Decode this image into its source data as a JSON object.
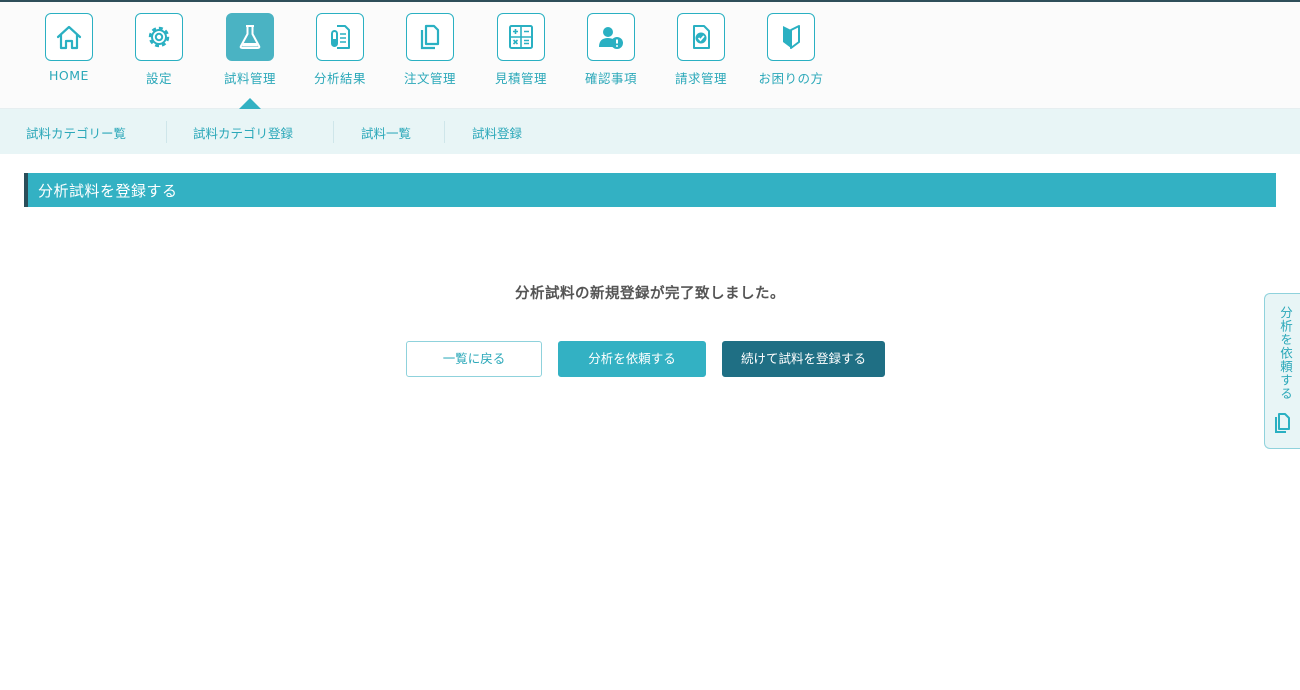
{
  "nav": {
    "items": [
      {
        "label": "HOME",
        "icon": "home-icon"
      },
      {
        "label": "設定",
        "icon": "gear-icon"
      },
      {
        "label": "試料管理",
        "icon": "flask-icon",
        "active": true
      },
      {
        "label": "分析結果",
        "icon": "test-tube-document-icon"
      },
      {
        "label": "注文管理",
        "icon": "copy-document-icon"
      },
      {
        "label": "見積管理",
        "icon": "calculator-icon"
      },
      {
        "label": "確認事項",
        "icon": "user-alert-icon"
      },
      {
        "label": "請求管理",
        "icon": "document-check-icon"
      },
      {
        "label": "お困りの方",
        "icon": "beginner-mark-icon"
      }
    ]
  },
  "subnav": {
    "items": [
      "試料カテゴリー覧",
      "試料カテゴリ登録",
      "試料一覧",
      "試料登録"
    ]
  },
  "section": {
    "title": "分析試料を登録する"
  },
  "main": {
    "message": "分析試料の新規登録が完了致しました。",
    "buttons": {
      "back": "一覧に戻る",
      "request_analysis": "分析を依頼する",
      "continue_register": "続けて試料を登録する"
    }
  },
  "side_tab": {
    "label": "分析を依頼する",
    "icon": "copy-document-icon"
  },
  "colors": {
    "primary": "#33b1c3",
    "dark": "#1f6f84",
    "light_bg": "#e8f5f6",
    "accent_border": "#2a4e5a"
  }
}
